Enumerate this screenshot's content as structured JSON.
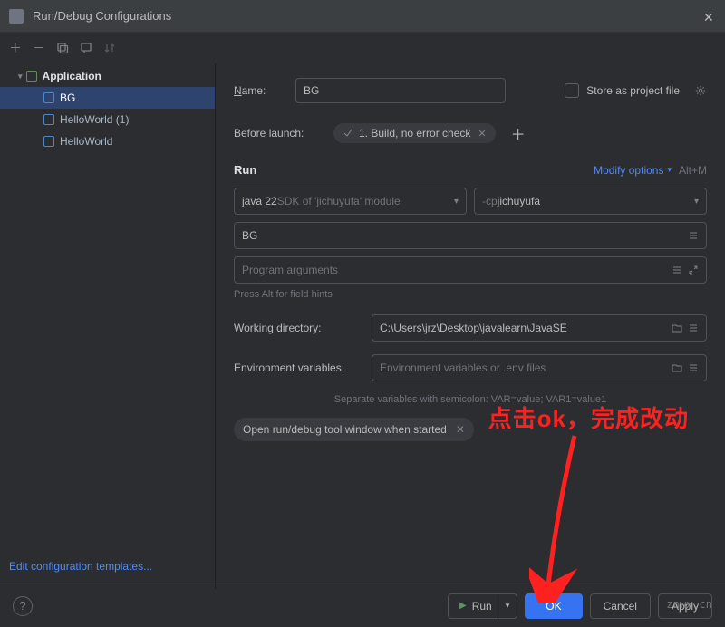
{
  "titlebar": {
    "title": "Run/Debug Configurations"
  },
  "sidebar": {
    "root": "Application",
    "items": [
      {
        "label": "BG",
        "selected": true
      },
      {
        "label": "HelloWorld (1)",
        "selected": false
      },
      {
        "label": "HelloWorld",
        "selected": false
      }
    ]
  },
  "form": {
    "name_label": "Name:",
    "name_value": "BG",
    "store_label": "Store as project file",
    "before_launch_label": "Before launch:",
    "task_label": "1. Build, no error check",
    "run_section": "Run",
    "modify_options": "Modify options",
    "modify_hint": "Alt+M",
    "sdk_value": "java 22",
    "sdk_hint": " SDK of 'jichuyufa' module",
    "cp_prefix": "-cp ",
    "cp_value": "jichuyufa",
    "main_class": "BG",
    "program_args_placeholder": "Program arguments",
    "field_hint": "Press Alt for field hints",
    "wd_label": "Working directory:",
    "wd_value": "C:\\Users\\jrz\\Desktop\\javalearn\\JavaSE",
    "env_label": "Environment variables:",
    "env_placeholder": "Environment variables or .env files",
    "separate_hint": "Separate variables with semicolon: VAR=value; VAR1=value1",
    "open_tool_label": "Open run/debug tool window when started"
  },
  "edit_templates": "Edit configuration templates...",
  "footer": {
    "run": "Run",
    "ok": "OK",
    "cancel": "Cancel",
    "apply": "Apply"
  },
  "annotation": "点击ok，完成改动",
  "watermark": "znwx.cn"
}
